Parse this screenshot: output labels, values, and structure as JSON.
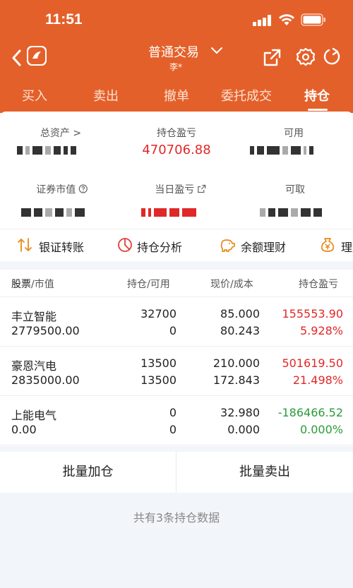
{
  "status_bar": {
    "time": "11:51"
  },
  "nav": {
    "title": "普通交易",
    "subtitle": "李*"
  },
  "tabs": [
    {
      "label": "买入",
      "active": false
    },
    {
      "label": "卖出",
      "active": false
    },
    {
      "label": "撤单",
      "active": false
    },
    {
      "label": "委托成交",
      "active": false
    },
    {
      "label": "持仓",
      "active": true
    }
  ],
  "summary": {
    "total_assets_label": "总资产",
    "position_pnl_label": "持仓盈亏",
    "position_pnl_value": "470706.88",
    "available_label": "可用",
    "market_value_label": "证券市值",
    "daily_pnl_label": "当日盈亏",
    "withdrawable_label": "可取"
  },
  "quicklinks": [
    {
      "label": "银证转账",
      "icon": "transfer-icon"
    },
    {
      "label": "持仓分析",
      "icon": "pie-chart-icon"
    },
    {
      "label": "余额理财",
      "icon": "piggy-bank-icon"
    },
    {
      "label": "理财",
      "icon": "money-bag-icon"
    }
  ],
  "table": {
    "headers": {
      "stock": "股票",
      "market_value": "市值",
      "position": "持仓",
      "available": "可用",
      "price": "现价",
      "cost": "成本",
      "pnl": "持仓盈亏"
    },
    "rows": [
      {
        "name": "丰立智能",
        "market_value": "2779500.00",
        "position": "32700",
        "available": "0",
        "price": "85.000",
        "cost": "80.243",
        "pnl": "155553.90",
        "pnl_pct": "5.928%",
        "trend": "up"
      },
      {
        "name": "豪恩汽电",
        "market_value": "2835000.00",
        "position": "13500",
        "available": "13500",
        "price": "210.000",
        "cost": "172.843",
        "pnl": "501619.50",
        "pnl_pct": "21.498%",
        "trend": "up"
      },
      {
        "name": "上能电气",
        "market_value": "0.00",
        "position": "0",
        "available": "0",
        "price": "32.980",
        "cost": "0.000",
        "pnl": "-186466.52",
        "pnl_pct": "0.000%",
        "trend": "down"
      }
    ]
  },
  "actions": {
    "batch_add": "批量加仓",
    "batch_sell": "批量卖出"
  },
  "footer_note": "共有3条持仓数据",
  "colors": {
    "brand_orange": "#e4602a",
    "profit_red": "#e02828",
    "loss_green": "#2b9a3a"
  }
}
